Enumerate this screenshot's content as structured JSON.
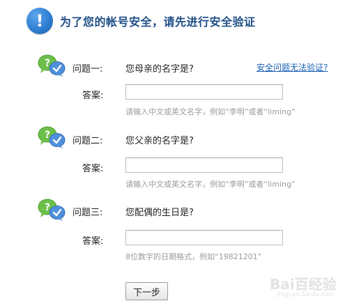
{
  "header": {
    "icon": "exclamation-icon",
    "mark": "!",
    "title": "为了您的帐号安全，请先进行安全验证"
  },
  "help_link": "安全问题无法验证?",
  "questions": [
    {
      "label": "问题一:",
      "text": "您母亲的名字是?",
      "answer_label": "答案:",
      "answer_value": "",
      "hint": "请输入中文或英文名字，例如“李明”或者“liming”"
    },
    {
      "label": "问题二:",
      "text": "您父亲的名字是?",
      "answer_label": "答案:",
      "answer_value": "",
      "hint": "请输入中文或英文名字，例如“李明”或者“liming”"
    },
    {
      "label": "问题三:",
      "text": "您配偶的生日是?",
      "answer_label": "答案:",
      "answer_value": "",
      "hint": "8位数字的日期格式，例如“19821201”"
    }
  ],
  "next_button": "下一步",
  "watermark": {
    "logo": "Bai百经验",
    "sub": "jingyan.baidu.com"
  },
  "colors": {
    "title": "#1f4f86",
    "link": "#1a5fb4",
    "hint": "#9a9a9a",
    "bubble_green": "#6cc04a",
    "bubble_blue": "#4f8fdc"
  }
}
